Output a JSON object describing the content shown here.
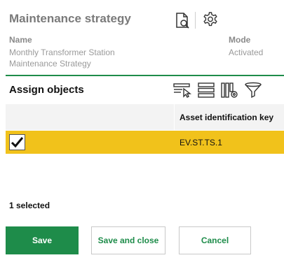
{
  "header": {
    "title": "Maintenance strategy",
    "name_label": "Name",
    "name_value_line1": "Monthly Transformer Station",
    "name_value_line2": "Maintenance Strategy",
    "mode_label": "Mode",
    "mode_value": "Activated",
    "icons": [
      "document-search-icon",
      "gear-icon"
    ]
  },
  "assign": {
    "title": "Assign objects",
    "toolbar_icons": [
      "select-rows-icon",
      "list-icon",
      "column-settings-icon",
      "filter-icon"
    ]
  },
  "table": {
    "columns": [
      "",
      "Asset identification key"
    ],
    "rows": [
      {
        "checked": true,
        "asset_key": "EV.ST.TS.1"
      }
    ]
  },
  "selection_info": "1 selected",
  "buttons": {
    "save": "Save",
    "save_close": "Save and close",
    "cancel": "Cancel"
  },
  "colors": {
    "accent": "#1e8c4a",
    "row_selected": "#f1c21b"
  }
}
